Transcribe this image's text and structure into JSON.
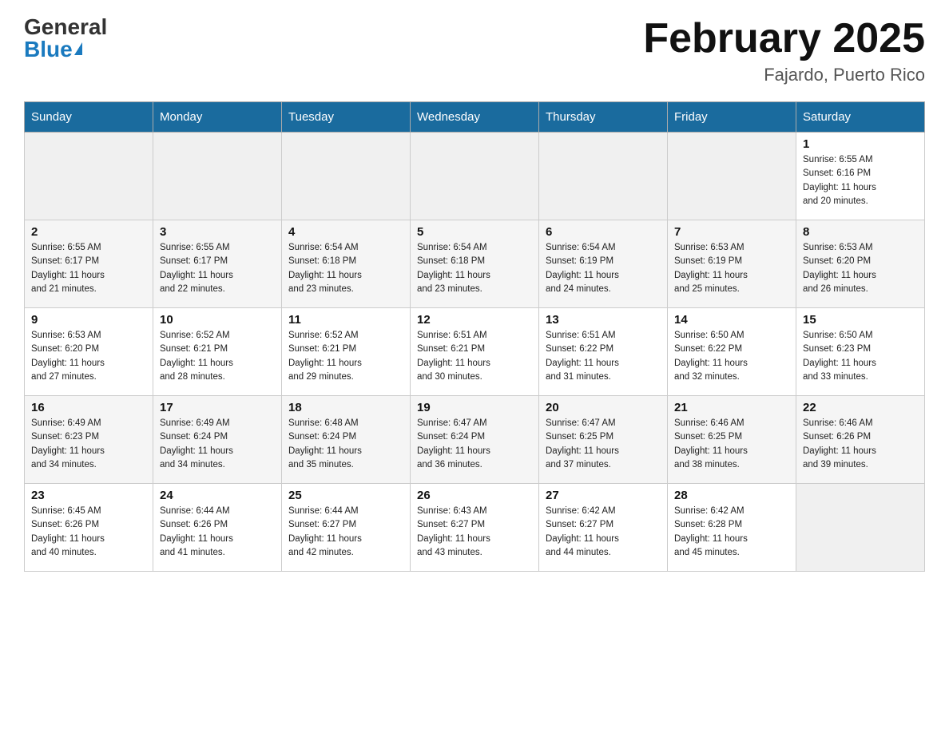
{
  "header": {
    "logo_general": "General",
    "logo_blue": "Blue",
    "month_title": "February 2025",
    "location": "Fajardo, Puerto Rico"
  },
  "weekdays": [
    "Sunday",
    "Monday",
    "Tuesday",
    "Wednesday",
    "Thursday",
    "Friday",
    "Saturday"
  ],
  "weeks": [
    [
      {
        "day": "",
        "info": ""
      },
      {
        "day": "",
        "info": ""
      },
      {
        "day": "",
        "info": ""
      },
      {
        "day": "",
        "info": ""
      },
      {
        "day": "",
        "info": ""
      },
      {
        "day": "",
        "info": ""
      },
      {
        "day": "1",
        "info": "Sunrise: 6:55 AM\nSunset: 6:16 PM\nDaylight: 11 hours\nand 20 minutes."
      }
    ],
    [
      {
        "day": "2",
        "info": "Sunrise: 6:55 AM\nSunset: 6:17 PM\nDaylight: 11 hours\nand 21 minutes."
      },
      {
        "day": "3",
        "info": "Sunrise: 6:55 AM\nSunset: 6:17 PM\nDaylight: 11 hours\nand 22 minutes."
      },
      {
        "day": "4",
        "info": "Sunrise: 6:54 AM\nSunset: 6:18 PM\nDaylight: 11 hours\nand 23 minutes."
      },
      {
        "day": "5",
        "info": "Sunrise: 6:54 AM\nSunset: 6:18 PM\nDaylight: 11 hours\nand 23 minutes."
      },
      {
        "day": "6",
        "info": "Sunrise: 6:54 AM\nSunset: 6:19 PM\nDaylight: 11 hours\nand 24 minutes."
      },
      {
        "day": "7",
        "info": "Sunrise: 6:53 AM\nSunset: 6:19 PM\nDaylight: 11 hours\nand 25 minutes."
      },
      {
        "day": "8",
        "info": "Sunrise: 6:53 AM\nSunset: 6:20 PM\nDaylight: 11 hours\nand 26 minutes."
      }
    ],
    [
      {
        "day": "9",
        "info": "Sunrise: 6:53 AM\nSunset: 6:20 PM\nDaylight: 11 hours\nand 27 minutes."
      },
      {
        "day": "10",
        "info": "Sunrise: 6:52 AM\nSunset: 6:21 PM\nDaylight: 11 hours\nand 28 minutes."
      },
      {
        "day": "11",
        "info": "Sunrise: 6:52 AM\nSunset: 6:21 PM\nDaylight: 11 hours\nand 29 minutes."
      },
      {
        "day": "12",
        "info": "Sunrise: 6:51 AM\nSunset: 6:21 PM\nDaylight: 11 hours\nand 30 minutes."
      },
      {
        "day": "13",
        "info": "Sunrise: 6:51 AM\nSunset: 6:22 PM\nDaylight: 11 hours\nand 31 minutes."
      },
      {
        "day": "14",
        "info": "Sunrise: 6:50 AM\nSunset: 6:22 PM\nDaylight: 11 hours\nand 32 minutes."
      },
      {
        "day": "15",
        "info": "Sunrise: 6:50 AM\nSunset: 6:23 PM\nDaylight: 11 hours\nand 33 minutes."
      }
    ],
    [
      {
        "day": "16",
        "info": "Sunrise: 6:49 AM\nSunset: 6:23 PM\nDaylight: 11 hours\nand 34 minutes."
      },
      {
        "day": "17",
        "info": "Sunrise: 6:49 AM\nSunset: 6:24 PM\nDaylight: 11 hours\nand 34 minutes."
      },
      {
        "day": "18",
        "info": "Sunrise: 6:48 AM\nSunset: 6:24 PM\nDaylight: 11 hours\nand 35 minutes."
      },
      {
        "day": "19",
        "info": "Sunrise: 6:47 AM\nSunset: 6:24 PM\nDaylight: 11 hours\nand 36 minutes."
      },
      {
        "day": "20",
        "info": "Sunrise: 6:47 AM\nSunset: 6:25 PM\nDaylight: 11 hours\nand 37 minutes."
      },
      {
        "day": "21",
        "info": "Sunrise: 6:46 AM\nSunset: 6:25 PM\nDaylight: 11 hours\nand 38 minutes."
      },
      {
        "day": "22",
        "info": "Sunrise: 6:46 AM\nSunset: 6:26 PM\nDaylight: 11 hours\nand 39 minutes."
      }
    ],
    [
      {
        "day": "23",
        "info": "Sunrise: 6:45 AM\nSunset: 6:26 PM\nDaylight: 11 hours\nand 40 minutes."
      },
      {
        "day": "24",
        "info": "Sunrise: 6:44 AM\nSunset: 6:26 PM\nDaylight: 11 hours\nand 41 minutes."
      },
      {
        "day": "25",
        "info": "Sunrise: 6:44 AM\nSunset: 6:27 PM\nDaylight: 11 hours\nand 42 minutes."
      },
      {
        "day": "26",
        "info": "Sunrise: 6:43 AM\nSunset: 6:27 PM\nDaylight: 11 hours\nand 43 minutes."
      },
      {
        "day": "27",
        "info": "Sunrise: 6:42 AM\nSunset: 6:27 PM\nDaylight: 11 hours\nand 44 minutes."
      },
      {
        "day": "28",
        "info": "Sunrise: 6:42 AM\nSunset: 6:28 PM\nDaylight: 11 hours\nand 45 minutes."
      },
      {
        "day": "",
        "info": ""
      }
    ]
  ]
}
